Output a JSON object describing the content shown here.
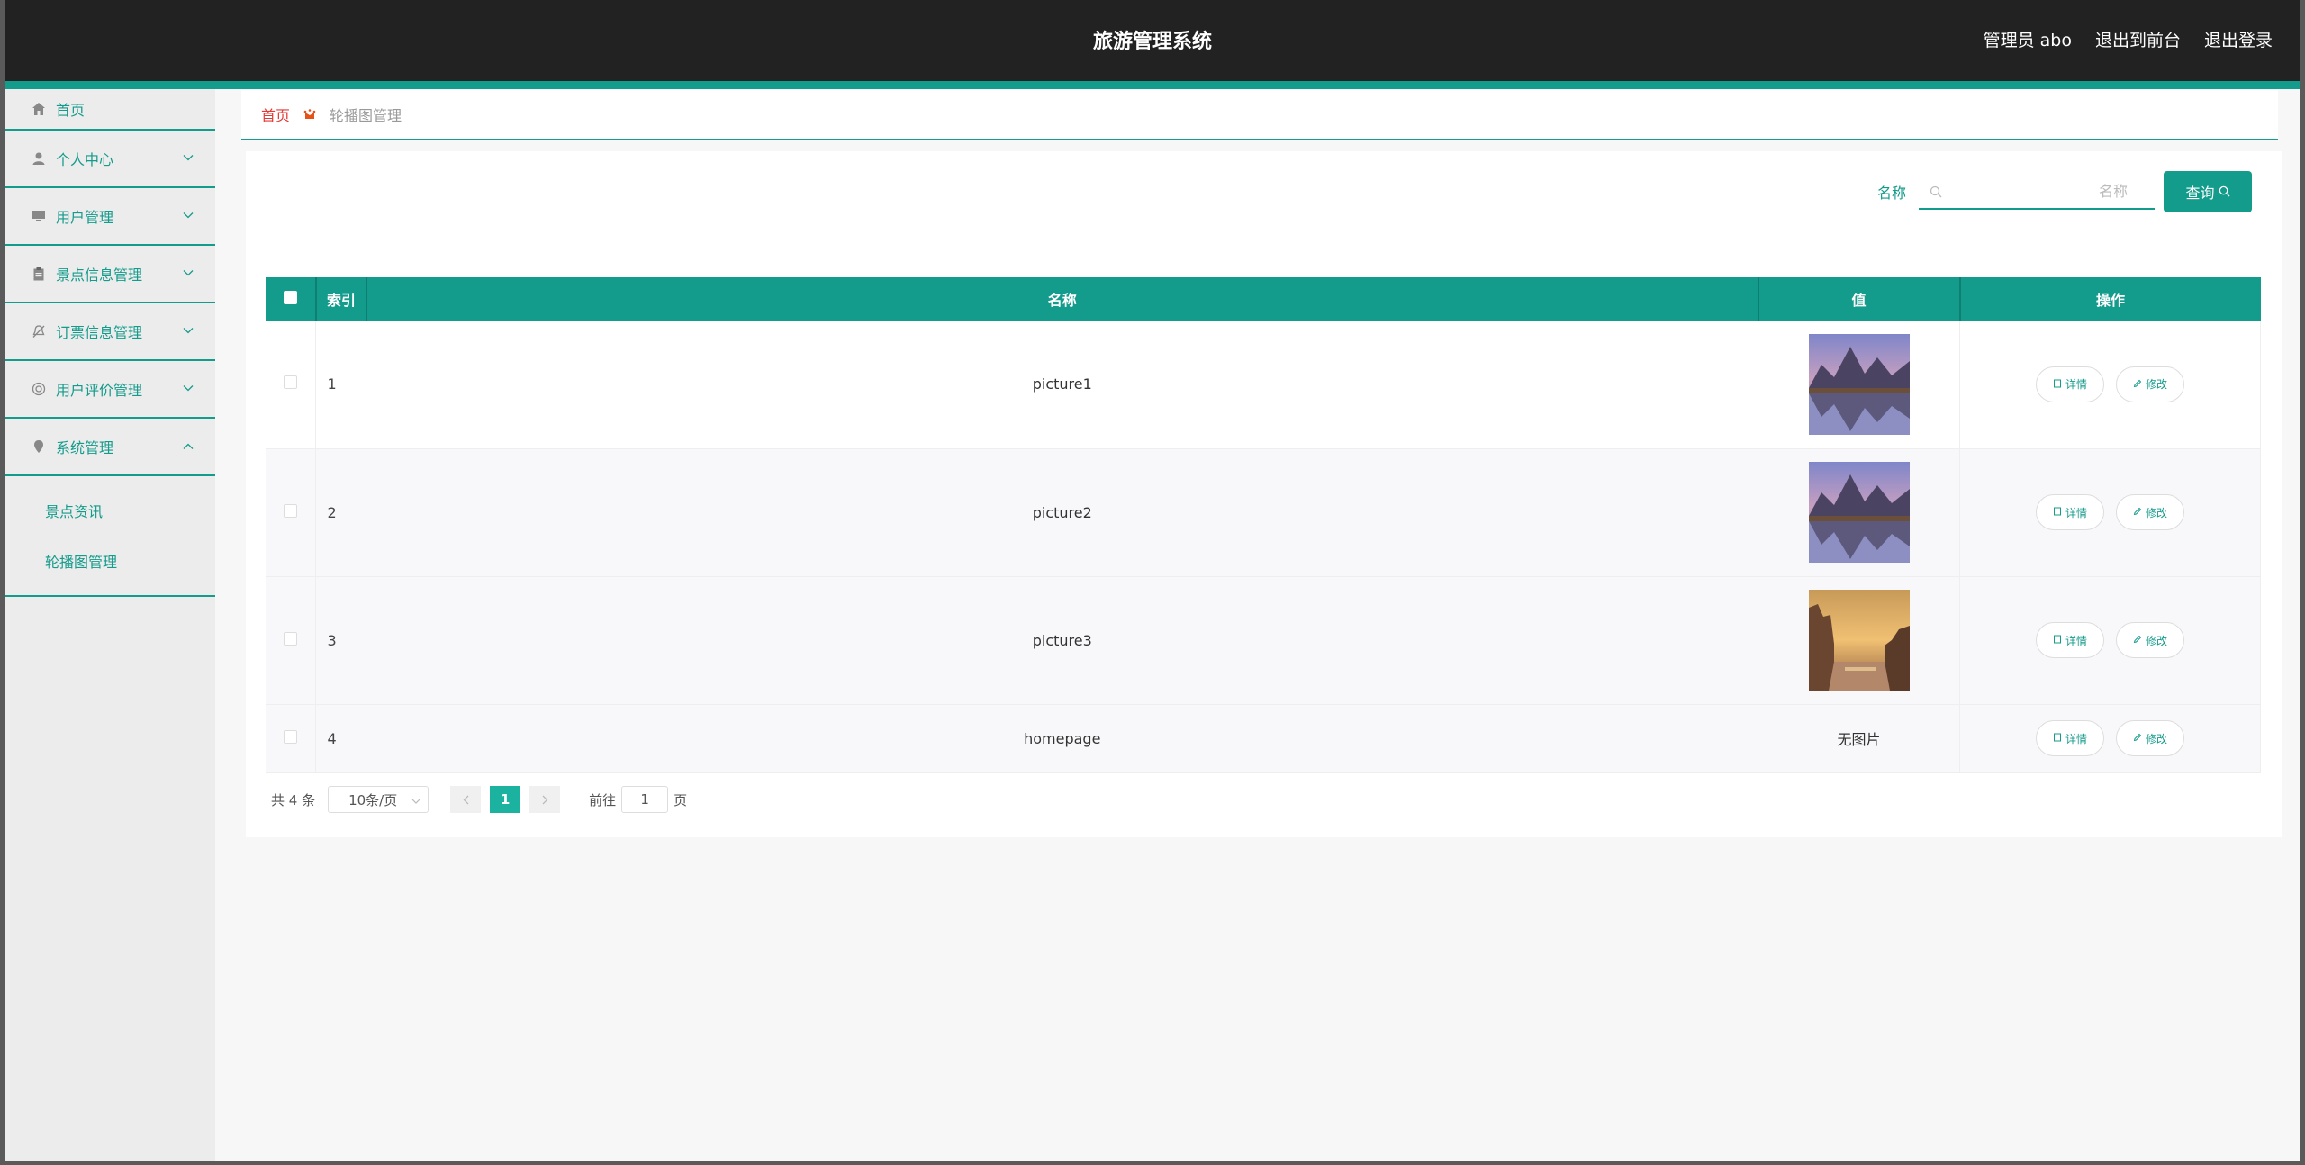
{
  "header": {
    "title": "旅游管理系统",
    "admin": "管理员 abo",
    "to_front": "退出到前台",
    "logout": "退出登录"
  },
  "sidebar": {
    "items": [
      {
        "label": "首页",
        "icon": "home-icon"
      },
      {
        "label": "个人中心",
        "icon": "user-icon",
        "arrow": "chevron-down"
      },
      {
        "label": "用户管理",
        "icon": "monitor-icon",
        "arrow": "chevron-down"
      },
      {
        "label": "景点信息管理",
        "icon": "clipboard-icon",
        "arrow": "chevron-down"
      },
      {
        "label": "订票信息管理",
        "icon": "bell-icon",
        "arrow": "chevron-down"
      },
      {
        "label": "用户评价管理",
        "icon": "support-icon",
        "arrow": "chevron-down"
      },
      {
        "label": "系统管理",
        "icon": "pin-icon",
        "arrow": "chevron-up"
      }
    ],
    "submenu": [
      "景点资讯",
      "轮播图管理"
    ]
  },
  "breadcrumb": {
    "home": "首页",
    "current": "轮播图管理"
  },
  "search": {
    "label": "名称",
    "placeholder": "名称",
    "button": "查询"
  },
  "table": {
    "headers": [
      "索引",
      "名称",
      "值",
      "操作"
    ],
    "rows": [
      {
        "index": "1",
        "name": "picture1",
        "value": "image-mountain-lake"
      },
      {
        "index": "2",
        "name": "picture2",
        "value": "image-mountain-lake"
      },
      {
        "index": "3",
        "name": "picture3",
        "value": "image-sunset-canal"
      },
      {
        "index": "4",
        "name": "homepage",
        "value_text": "无图片"
      }
    ],
    "detail_label": "详情",
    "edit_label": "修改"
  },
  "pagination": {
    "total": "共 4 条",
    "page_size": "10条/页",
    "current_page": "1",
    "goto_prefix": "前往",
    "goto_value": "1",
    "goto_suffix": "页"
  },
  "colors": {
    "accent": "#139b8b",
    "header_bg": "#222222",
    "breadcrumb_home": "#e53935"
  }
}
